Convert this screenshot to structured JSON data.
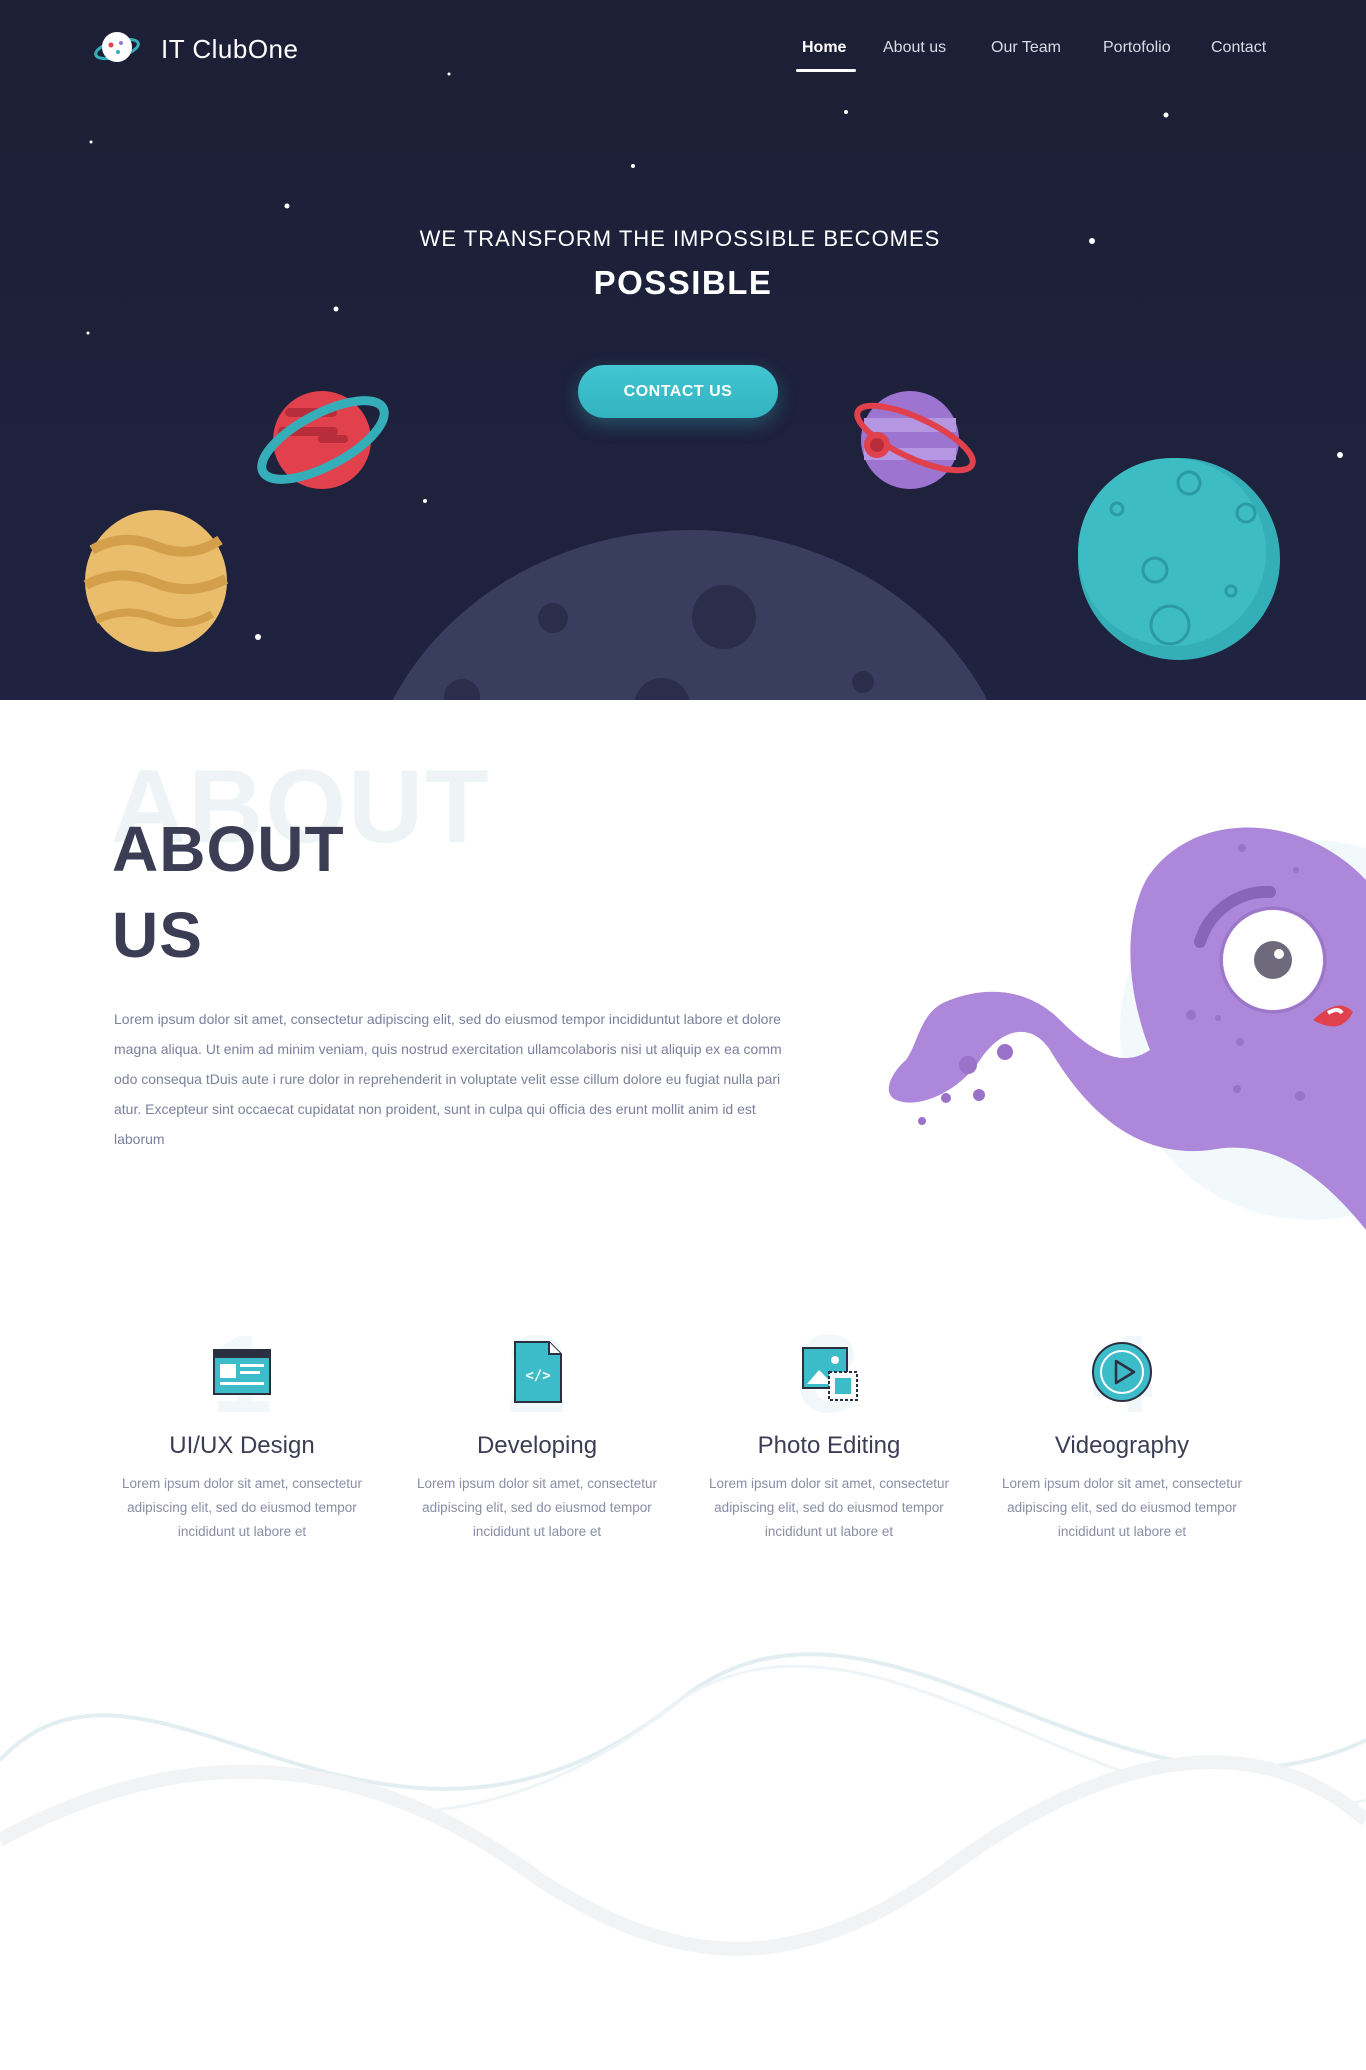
{
  "brand": {
    "name": "IT ClubOne",
    "logo_icon": "planet-logo-icon"
  },
  "nav": {
    "items": [
      {
        "label": "Home",
        "active": true
      },
      {
        "label": "About us",
        "active": false
      },
      {
        "label": "Our Team",
        "active": false
      },
      {
        "label": "Portofolio",
        "active": false
      },
      {
        "label": "Contact",
        "active": false
      }
    ]
  },
  "hero": {
    "subtitle": "WE TRANSFORM THE IMPOSSIBLE BECOMES",
    "title": "POSSIBLE",
    "cta_label": "CONTACT US"
  },
  "about": {
    "ghost_text": "ABOUT",
    "title_line1": "ABOUT",
    "title_line2": "US",
    "paragraph": "Lorem ipsum dolor sit amet, consectetur adipiscing elit, sed do eiusmod tempor incididuntut labore et dolore magna aliqua. Ut enim ad minim veniam, quis nostrud exercitation ullamcolaboris nisi ut aliquip ex ea comm odo consequa tDuis aute i rure dolor in reprehenderit in voluptate velit esse cillum dolore eu fugiat nulla  pari atur. Excepteur sint occaecat  cupidatat non proident, sunt in culpa qui officia des erunt mollit anim id est laborum"
  },
  "services": [
    {
      "number": "1",
      "title": "UI/UX Design",
      "icon": "browser-window-icon",
      "desc": "Lorem ipsum dolor sit amet, consectetur adipiscing elit, sed do eiusmod tempor incididunt ut labore et"
    },
    {
      "number": "2",
      "title": "Developing",
      "icon": "code-file-icon",
      "desc": "Lorem ipsum dolor sit amet, consectetur adipiscing elit, sed do eiusmod tempor incididunt ut labore et"
    },
    {
      "number": "3",
      "title": "Photo Editing",
      "icon": "image-edit-icon",
      "desc": "Lorem ipsum dolor sit amet, consectetur adipiscing elit, sed do eiusmod tempor incididunt ut labore et"
    },
    {
      "number": "4",
      "title": "Videography",
      "icon": "play-circle-icon",
      "desc": "Lorem ipsum dolor sit amet, consectetur adipiscing elit, sed do eiusmod tempor incididunt ut labore et"
    }
  ],
  "colors": {
    "hero_bg": "#1c1f35",
    "accent": "#3cbcc8",
    "heading": "#3c3d55",
    "body_text": "#7b7f9c",
    "monster": "#ad87da"
  }
}
